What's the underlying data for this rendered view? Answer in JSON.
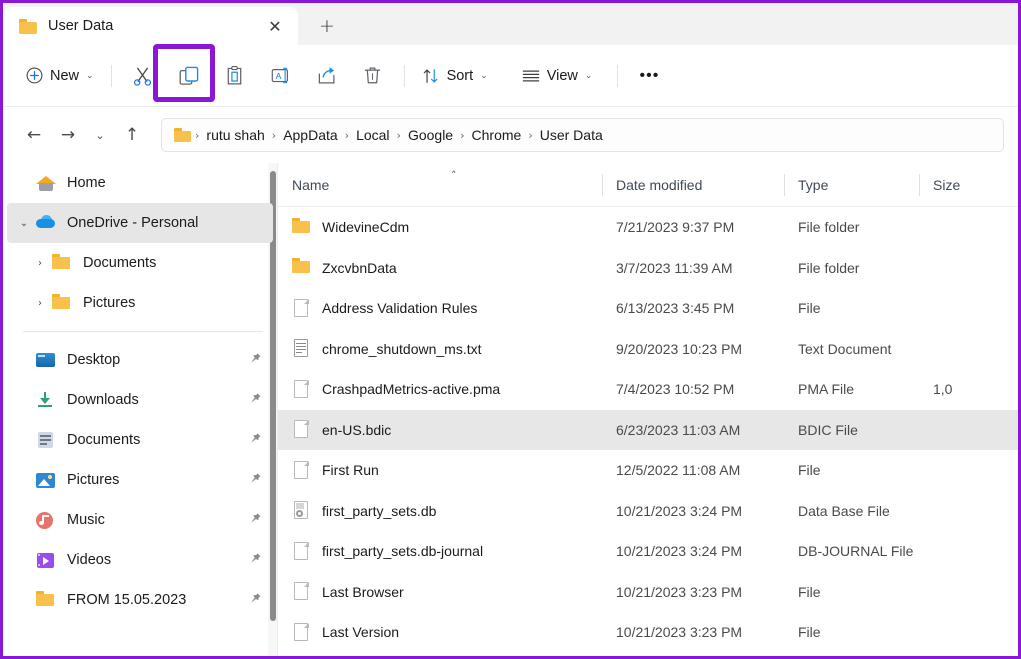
{
  "window": {
    "accent_highlight_color": "#8a16d6"
  },
  "tabbar": {
    "tab_title": "User Data",
    "tab_icon": "folder-icon",
    "close_label": "✕",
    "new_tab_label": "+"
  },
  "toolbar": {
    "new_label": "New",
    "new_chevron": "⌄",
    "cut_icon": "scissors-icon",
    "copy_icon": "copy-icon",
    "paste_icon": "clipboard-paste-icon",
    "rename_icon": "rename-icon",
    "share_icon": "share-icon",
    "delete_icon": "trash-icon",
    "sort_label": "Sort",
    "sort_icon": "sort-arrows-icon",
    "view_label": "View",
    "view_icon": "view-lines-icon",
    "more_label": "•••",
    "chevron": "⌄",
    "highlighted_button": "copy"
  },
  "addressbar": {
    "back_icon": "←",
    "forward_icon": "→",
    "recent_icon": "⌄",
    "up_icon": "↑",
    "path_icon": "folder-icon",
    "separator": "›",
    "crumbs": [
      "rutu shah",
      "AppData",
      "Local",
      "Google",
      "Chrome",
      "User Data"
    ]
  },
  "sidebar": {
    "items": [
      {
        "label": "Home",
        "icon": "home-icon",
        "expander": "",
        "indent": false,
        "pin": false,
        "selected": false
      },
      {
        "label": "OneDrive - Personal",
        "icon": "cloud-icon",
        "expander": "⌄",
        "indent": false,
        "pin": false,
        "selected": true
      },
      {
        "label": "Documents",
        "icon": "folder-icon",
        "expander": "›",
        "indent": true,
        "pin": false,
        "selected": false
      },
      {
        "label": "Pictures",
        "icon": "folder-icon",
        "expander": "›",
        "indent": true,
        "pin": false,
        "selected": false
      }
    ],
    "quick_items": [
      {
        "label": "Desktop",
        "icon": "desktop-icon",
        "pin": true
      },
      {
        "label": "Downloads",
        "icon": "download-icon",
        "pin": true
      },
      {
        "label": "Documents",
        "icon": "document-icon",
        "pin": true
      },
      {
        "label": "Pictures",
        "icon": "picture-icon",
        "pin": true
      },
      {
        "label": "Music",
        "icon": "music-icon",
        "pin": true
      },
      {
        "label": "Videos",
        "icon": "video-icon",
        "pin": true
      },
      {
        "label": "FROM 15.05.2023",
        "icon": "folder-icon",
        "pin": true
      }
    ],
    "pin_glyph": "📌"
  },
  "filelist": {
    "columns": {
      "name": "Name",
      "date_modified": "Date modified",
      "type": "Type",
      "size": "Size"
    },
    "sort_indicator": "˄",
    "sorted_column": "Name",
    "rows": [
      {
        "name": "WidevineCdm",
        "date": "7/21/2023 9:37 PM",
        "type": "File folder",
        "size": "",
        "icon": "folder-icon",
        "selected": false
      },
      {
        "name": "ZxcvbnData",
        "date": "3/7/2023 11:39 AM",
        "type": "File folder",
        "size": "",
        "icon": "folder-icon",
        "selected": false
      },
      {
        "name": "Address Validation Rules",
        "date": "6/13/2023 3:45 PM",
        "type": "File",
        "size": "",
        "icon": "file-icon",
        "selected": false
      },
      {
        "name": "chrome_shutdown_ms.txt",
        "date": "9/20/2023 10:23 PM",
        "type": "Text Document",
        "size": "",
        "icon": "text-icon",
        "selected": false
      },
      {
        "name": "CrashpadMetrics-active.pma",
        "date": "7/4/2023 10:52 PM",
        "type": "PMA File",
        "size": "1,0",
        "icon": "file-icon",
        "selected": false
      },
      {
        "name": "en-US.bdic",
        "date": "6/23/2023 11:03 AM",
        "type": "BDIC File",
        "size": "",
        "icon": "file-icon",
        "selected": true
      },
      {
        "name": "First Run",
        "date": "12/5/2022 11:08 AM",
        "type": "File",
        "size": "",
        "icon": "file-icon",
        "selected": false
      },
      {
        "name": "first_party_sets.db",
        "date": "10/21/2023 3:24 PM",
        "type": "Data Base File",
        "size": "",
        "icon": "db-icon",
        "selected": false
      },
      {
        "name": "first_party_sets.db-journal",
        "date": "10/21/2023 3:24 PM",
        "type": "DB-JOURNAL File",
        "size": "",
        "icon": "file-icon",
        "selected": false
      },
      {
        "name": "Last Browser",
        "date": "10/21/2023 3:23 PM",
        "type": "File",
        "size": "",
        "icon": "file-icon",
        "selected": false
      },
      {
        "name": "Last Version",
        "date": "10/21/2023 3:23 PM",
        "type": "File",
        "size": "",
        "icon": "file-icon",
        "selected": false
      }
    ]
  }
}
